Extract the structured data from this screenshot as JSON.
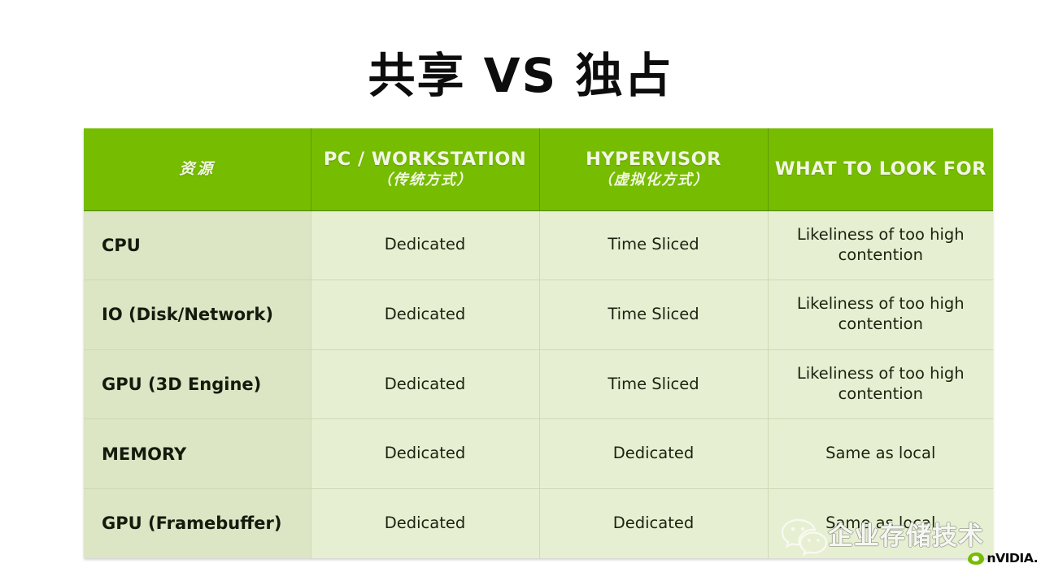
{
  "slide": {
    "title": "共享 VS 独占",
    "background_color": "#ffffff"
  },
  "theme": {
    "header_green": "#76bc00",
    "header_text": "#f2f7e2",
    "resource_column_fill": "#dce5c4",
    "value_column_fill": "#e7efd2",
    "grid_line": "#cfd9b6",
    "body_text": "#1b2310"
  },
  "table": {
    "columns": [
      {
        "key": "resource",
        "main": "资源",
        "sub": ""
      },
      {
        "key": "pc",
        "main": "PC / WORKSTATION",
        "sub": "（传统方式）"
      },
      {
        "key": "hypervisor",
        "main": "HYPERVISOR",
        "sub": "（虚拟化方式）"
      },
      {
        "key": "what",
        "main": "WHAT TO LOOK FOR",
        "sub": ""
      }
    ],
    "rows": [
      {
        "resource": "CPU",
        "pc": "Dedicated",
        "hypervisor": "Time Sliced",
        "what": "Likeliness of too high contention"
      },
      {
        "resource": "IO (Disk/Network)",
        "pc": "Dedicated",
        "hypervisor": "Time Sliced",
        "what": "Likeliness of too high contention"
      },
      {
        "resource": "GPU (3D Engine)",
        "pc": "Dedicated",
        "hypervisor": "Time Sliced",
        "what": "Likeliness of too high contention"
      },
      {
        "resource": "MEMORY",
        "pc": "Dedicated",
        "hypervisor": "Dedicated",
        "what": "Same as local"
      },
      {
        "resource": "GPU (Framebuffer)",
        "pc": "Dedicated",
        "hypervisor": "Dedicated",
        "what": "Same as local"
      }
    ]
  },
  "watermark": {
    "icon": "wechat-icon",
    "text": "企业存储技术"
  },
  "branding": {
    "logo_icon": "nvidia-eye-icon",
    "wordmark": "nVIDIA.",
    "color": "#76bc00"
  }
}
